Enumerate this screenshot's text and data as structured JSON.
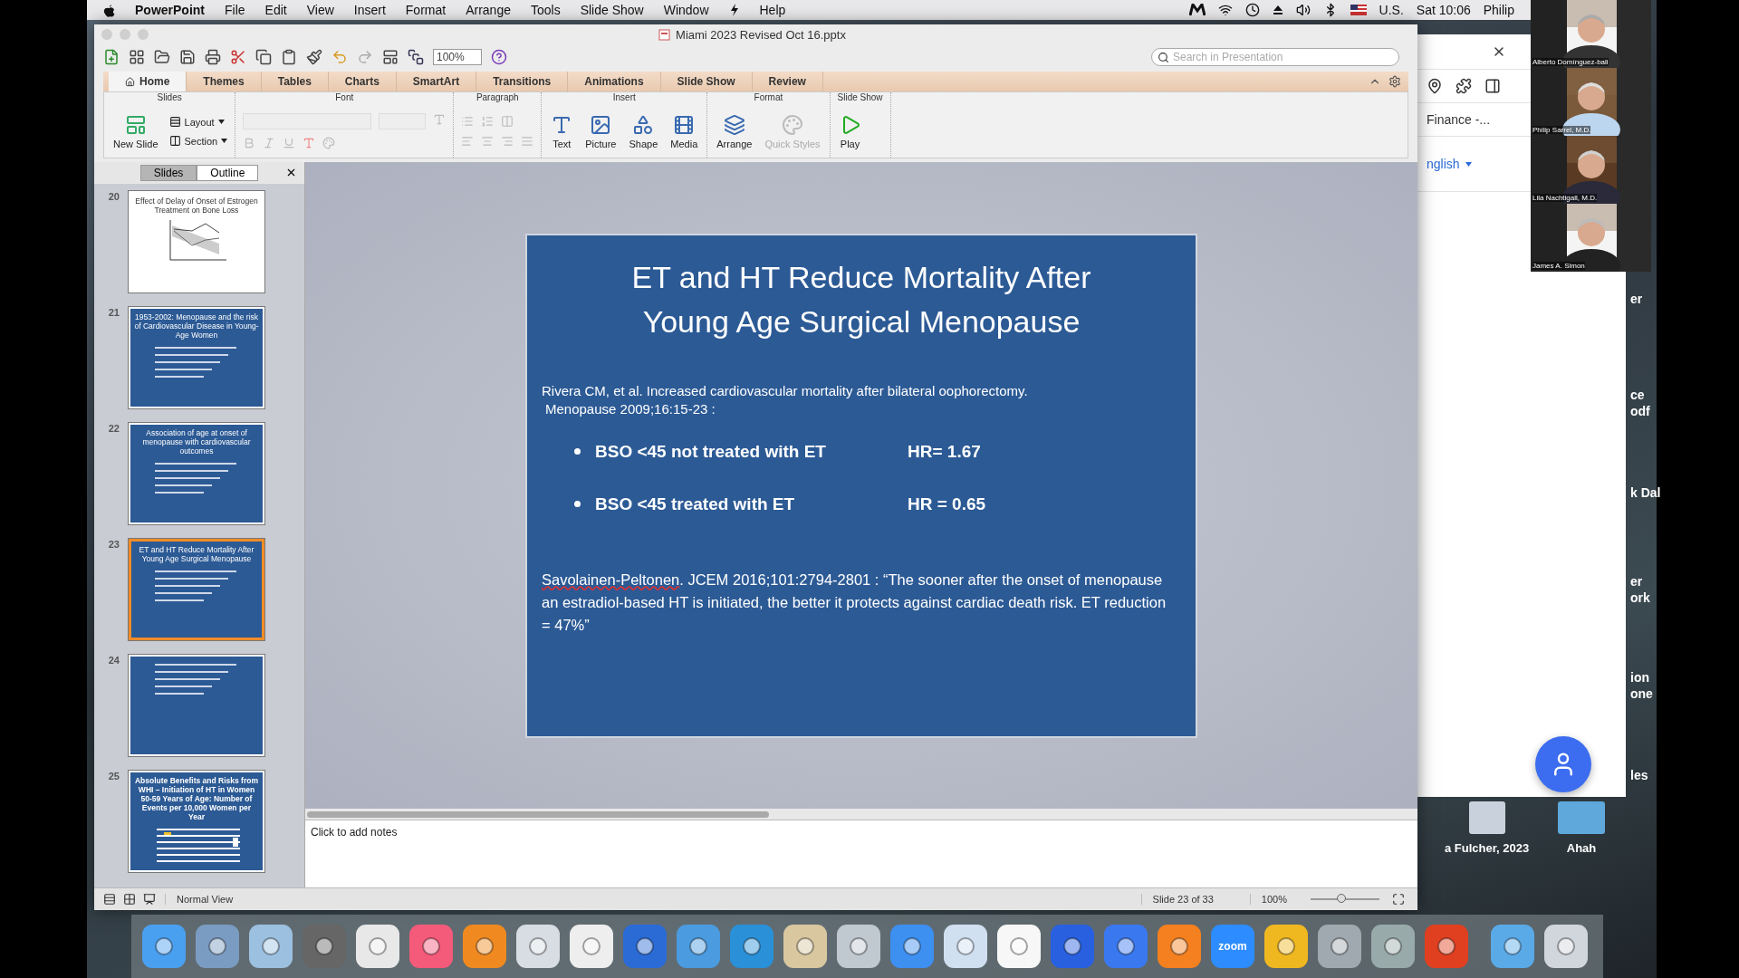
{
  "menubar": {
    "app": "PowerPoint",
    "items": [
      "File",
      "Edit",
      "View",
      "Insert",
      "Format",
      "Arrange",
      "Tools",
      "Slide Show",
      "Window",
      "Help"
    ],
    "input_source": "U.S.",
    "clock": "Sat 10:06",
    "user": "Philip"
  },
  "window": {
    "title": "Miami 2023 Revised Oct 16.pptx",
    "zoom": "100%",
    "search": {
      "placeholder": "Search in Presentation"
    }
  },
  "tabs": [
    {
      "label": "Home",
      "selected": true
    },
    {
      "label": "Themes",
      "selected": false
    },
    {
      "label": "Tables",
      "selected": false
    },
    {
      "label": "Charts",
      "selected": false
    },
    {
      "label": "SmartArt",
      "selected": false
    },
    {
      "label": "Transitions",
      "selected": false
    },
    {
      "label": "Animations",
      "selected": false
    },
    {
      "label": "Slide Show",
      "selected": false
    },
    {
      "label": "Review",
      "selected": false
    }
  ],
  "ribbon": [
    {
      "title": "Slides",
      "kind": "slides",
      "items": [
        {
          "label": "New Slide",
          "disabled": false
        },
        {
          "label": "Layout",
          "disabled": false
        },
        {
          "label": "Section",
          "disabled": false
        }
      ]
    },
    {
      "title": "Font",
      "kind": "font"
    },
    {
      "title": "Paragraph",
      "kind": "paragraph"
    },
    {
      "title": "Insert",
      "kind": "big",
      "items": [
        {
          "label": "Text",
          "disabled": false
        },
        {
          "label": "Picture",
          "disabled": false
        },
        {
          "label": "Shape",
          "disabled": false
        },
        {
          "label": "Media",
          "disabled": false
        }
      ]
    },
    {
      "title": "Format",
      "kind": "big",
      "items": [
        {
          "label": "Arrange",
          "disabled": false
        },
        {
          "label": "Quick Styles",
          "disabled": true
        }
      ]
    },
    {
      "title": "Slide Show",
      "kind": "big",
      "items": [
        {
          "label": "Play",
          "disabled": false
        }
      ]
    }
  ],
  "sidebar": {
    "tabs": [
      {
        "label": "Slides",
        "selected": true
      },
      {
        "label": "Outline",
        "selected": false
      }
    ],
    "thumbnails": [
      {
        "number": "20",
        "kind": "chart",
        "title": "Effect of Delay of Onset of Estrogen Treatment on Bone Loss",
        "selected": false
      },
      {
        "number": "21",
        "kind": "text",
        "title": "1953-2002: Menopause and the risk of Cardiovascular Disease in Young-Age Women",
        "selected": false
      },
      {
        "number": "22",
        "kind": "text",
        "title": "Association of age at onset of menopause with cardiovascular outcomes",
        "selected": false
      },
      {
        "number": "23",
        "kind": "text",
        "title": "ET and HT Reduce Mortality After Young Age Surgical Menopause",
        "selected": true
      },
      {
        "number": "24",
        "kind": "text",
        "selected": false
      },
      {
        "number": "25",
        "kind": "table",
        "title": "Absolute Benefits and Risks from WHI – Initiation of HT in Women 50-59 Years of Age: Number of Events per 10,000 Women per Year",
        "selected": false
      }
    ]
  },
  "slide": {
    "title_lines": [
      "ET and HT Reduce Mortality After",
      "Young Age Surgical Menopause"
    ],
    "citation_lines": [
      "Rivera CM, et al. Increased cardiovascular mortality after bilateral oophorectomy.",
      "Menopause 2009;16:15-23 :"
    ],
    "bullets": [
      {
        "text": "BSO <45 not treated with ET",
        "hr": "HR= 1.67"
      },
      {
        "text": "BSO <45 treated with ET",
        "hr": "HR = 0.65"
      }
    ],
    "quote": {
      "author": "Savolainen-Peltonen",
      "text": ". JCEM 2016;101:2794-2801 : “The sooner after the onset of menopause an estradiol-based HT is initiated, the better it protects against cardiac death risk. ET reduction = 47%”"
    }
  },
  "notes": {
    "placeholder": "Click to add notes"
  },
  "status_bar": {
    "view": "Normal View",
    "slide": "Slide 23 of 33",
    "zoom": "100%",
    "level": 0.45
  },
  "browser": {
    "tab": "Finance -...",
    "language": "nglish"
  },
  "video_tiles": [
    {
      "name": "Alberto Domínguez-bali"
    },
    {
      "name": "Philip Sarrel, M.D."
    },
    {
      "name": "Lila Nachtigall, M.D."
    },
    {
      "name": "James A. Simon"
    }
  ],
  "desktop": {
    "items": [
      {
        "label": "a Fulcher, 2023"
      },
      {
        "label": "Ahah"
      }
    ],
    "fragments": [
      "er",
      "ce",
      "odf",
      "k Dal",
      "er",
      "ork",
      "ion",
      "one",
      "les"
    ]
  },
  "dock": {
    "zoom_label": "zoom"
  }
}
